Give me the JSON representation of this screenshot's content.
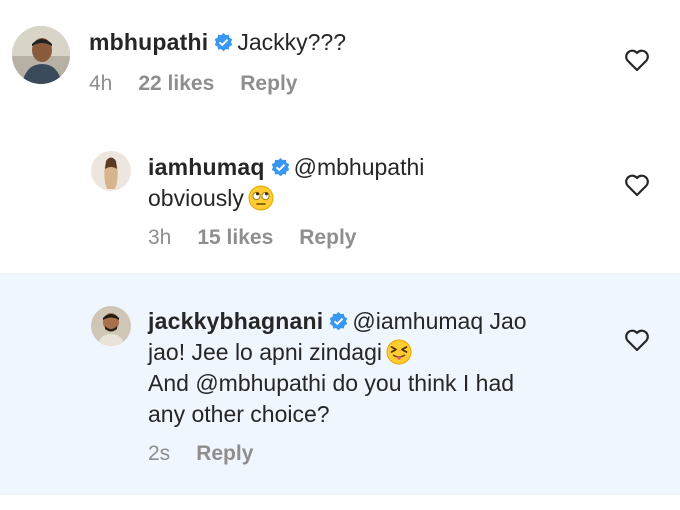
{
  "comments": [
    {
      "username": "mbhupathi",
      "text": "Jackky???",
      "time": "4h",
      "likes": "22 likes",
      "reply": "Reply",
      "avatar": "man-portrait",
      "icon": "heart-outline-icon"
    },
    {
      "username": "iamhumaq",
      "mention": "@mbhupathi",
      "text": "obviously",
      "emoji": "eye-roll-emoji",
      "time": "3h",
      "likes": "15 likes",
      "reply": "Reply",
      "avatar": "woman-portrait",
      "icon": "heart-outline-icon"
    },
    {
      "username": "jackkybhagnani",
      "mention": "@iamhumaq",
      "line1_rest": "Jao",
      "line2": "jao! Jee lo apni zindagi",
      "emoji": "tongue-out-wink-emoji",
      "line3": "And @mbhupathi do you think I had",
      "line4": "any other choice?",
      "time": "2s",
      "reply": "Reply",
      "avatar": "man-portrait",
      "icon": "heart-outline-icon"
    }
  ],
  "colors": {
    "text": "#262626",
    "meta": "#8e8e8e",
    "mention": "#262626",
    "verified": "#3897f0",
    "highlight_bg": "#eff6fd"
  }
}
